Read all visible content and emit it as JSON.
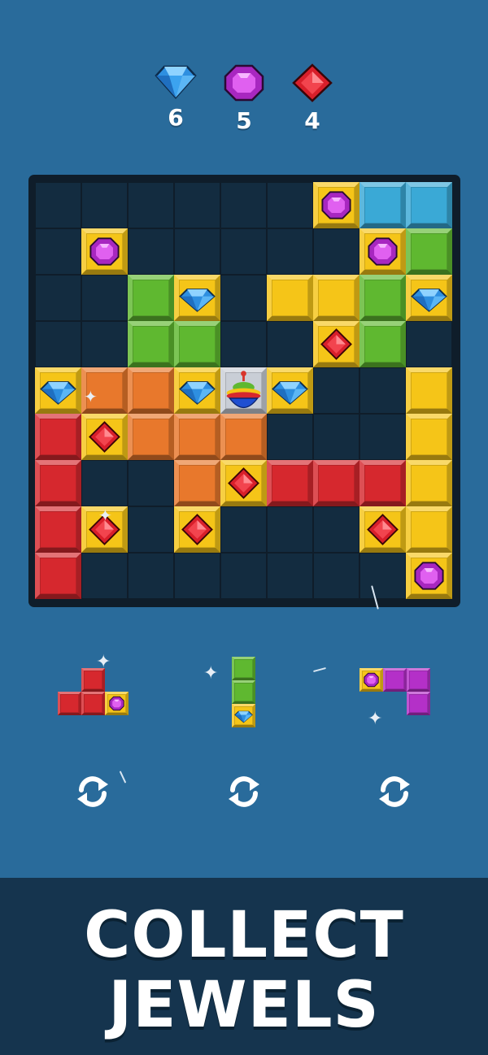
{
  "goals": [
    {
      "gem": "blue-diamond",
      "count": "6"
    },
    {
      "gem": "purple-gem",
      "count": "5"
    },
    {
      "gem": "red-gem",
      "count": "4"
    }
  ],
  "colors": {
    "background": "#296b9b",
    "board": "#0f1d2a",
    "cell": "#132c40",
    "banner": "#15344e",
    "yellow": "#f5c518",
    "orange": "#e8782c",
    "red": "#d6282e",
    "green": "#5fb830",
    "cyan": "#3aa9d6",
    "purple": "#b430c8"
  },
  "board": {
    "rows": 9,
    "cols": 9,
    "tiles": [
      {
        "r": 0,
        "c": 6,
        "color": "yellow",
        "gem": "purple"
      },
      {
        "r": 0,
        "c": 7,
        "color": "cyan"
      },
      {
        "r": 0,
        "c": 8,
        "color": "cyan"
      },
      {
        "r": 1,
        "c": 1,
        "color": "yellow",
        "gem": "purple"
      },
      {
        "r": 1,
        "c": 7,
        "color": "yellow",
        "gem": "purple"
      },
      {
        "r": 1,
        "c": 8,
        "color": "green"
      },
      {
        "r": 2,
        "c": 2,
        "color": "green"
      },
      {
        "r": 2,
        "c": 3,
        "color": "yellow",
        "gem": "blue"
      },
      {
        "r": 2,
        "c": 5,
        "color": "yellow"
      },
      {
        "r": 2,
        "c": 6,
        "color": "yellow"
      },
      {
        "r": 2,
        "c": 7,
        "color": "green"
      },
      {
        "r": 2,
        "c": 8,
        "color": "yellow",
        "gem": "blue"
      },
      {
        "r": 3,
        "c": 2,
        "color": "green"
      },
      {
        "r": 3,
        "c": 3,
        "color": "green"
      },
      {
        "r": 3,
        "c": 6,
        "color": "yellow",
        "gem": "red"
      },
      {
        "r": 3,
        "c": 7,
        "color": "green"
      },
      {
        "r": 4,
        "c": 0,
        "color": "yellow",
        "gem": "blue"
      },
      {
        "r": 4,
        "c": 1,
        "color": "orange"
      },
      {
        "r": 4,
        "c": 2,
        "color": "orange"
      },
      {
        "r": 4,
        "c": 3,
        "color": "yellow",
        "gem": "blue"
      },
      {
        "r": 4,
        "c": 4,
        "color": "silver",
        "gem": "top"
      },
      {
        "r": 4,
        "c": 5,
        "color": "yellow",
        "gem": "blue"
      },
      {
        "r": 4,
        "c": 8,
        "color": "yellow"
      },
      {
        "r": 5,
        "c": 0,
        "color": "red"
      },
      {
        "r": 5,
        "c": 1,
        "color": "yellow",
        "gem": "red"
      },
      {
        "r": 5,
        "c": 2,
        "color": "orange"
      },
      {
        "r": 5,
        "c": 3,
        "color": "orange"
      },
      {
        "r": 5,
        "c": 4,
        "color": "orange"
      },
      {
        "r": 5,
        "c": 8,
        "color": "yellow"
      },
      {
        "r": 6,
        "c": 0,
        "color": "red"
      },
      {
        "r": 6,
        "c": 3,
        "color": "orange"
      },
      {
        "r": 6,
        "c": 4,
        "color": "yellow",
        "gem": "red"
      },
      {
        "r": 6,
        "c": 5,
        "color": "red"
      },
      {
        "r": 6,
        "c": 6,
        "color": "red"
      },
      {
        "r": 6,
        "c": 7,
        "color": "red"
      },
      {
        "r": 6,
        "c": 8,
        "color": "yellow"
      },
      {
        "r": 7,
        "c": 0,
        "color": "red"
      },
      {
        "r": 7,
        "c": 1,
        "color": "yellow",
        "gem": "red"
      },
      {
        "r": 7,
        "c": 3,
        "color": "yellow",
        "gem": "red"
      },
      {
        "r": 7,
        "c": 7,
        "color": "yellow",
        "gem": "red"
      },
      {
        "r": 7,
        "c": 8,
        "color": "yellow"
      },
      {
        "r": 8,
        "c": 0,
        "color": "red"
      },
      {
        "r": 8,
        "c": 8,
        "color": "yellow",
        "gem": "purple"
      }
    ]
  },
  "pieces": [
    {
      "name": "piece-left",
      "tiles": [
        {
          "r": 0,
          "c": 1,
          "color": "red"
        },
        {
          "r": 1,
          "c": 0,
          "color": "red"
        },
        {
          "r": 1,
          "c": 1,
          "color": "red"
        },
        {
          "r": 1,
          "c": 2,
          "color": "yellow",
          "gem": "purple"
        }
      ]
    },
    {
      "name": "piece-middle",
      "tiles": [
        {
          "r": 0,
          "c": 0,
          "color": "green"
        },
        {
          "r": 1,
          "c": 0,
          "color": "green"
        },
        {
          "r": 2,
          "c": 0,
          "color": "yellow",
          "gem": "blue"
        }
      ]
    },
    {
      "name": "piece-right",
      "tiles": [
        {
          "r": 0,
          "c": 0,
          "color": "yellow",
          "gem": "purple"
        },
        {
          "r": 0,
          "c": 1,
          "color": "purple"
        },
        {
          "r": 0,
          "c": 2,
          "color": "purple"
        },
        {
          "r": 1,
          "c": 2,
          "color": "purple"
        }
      ]
    }
  ],
  "rotate_icon": "rotate-icon",
  "banner": {
    "line1": "COLLECT",
    "line2": "JEWELS"
  }
}
